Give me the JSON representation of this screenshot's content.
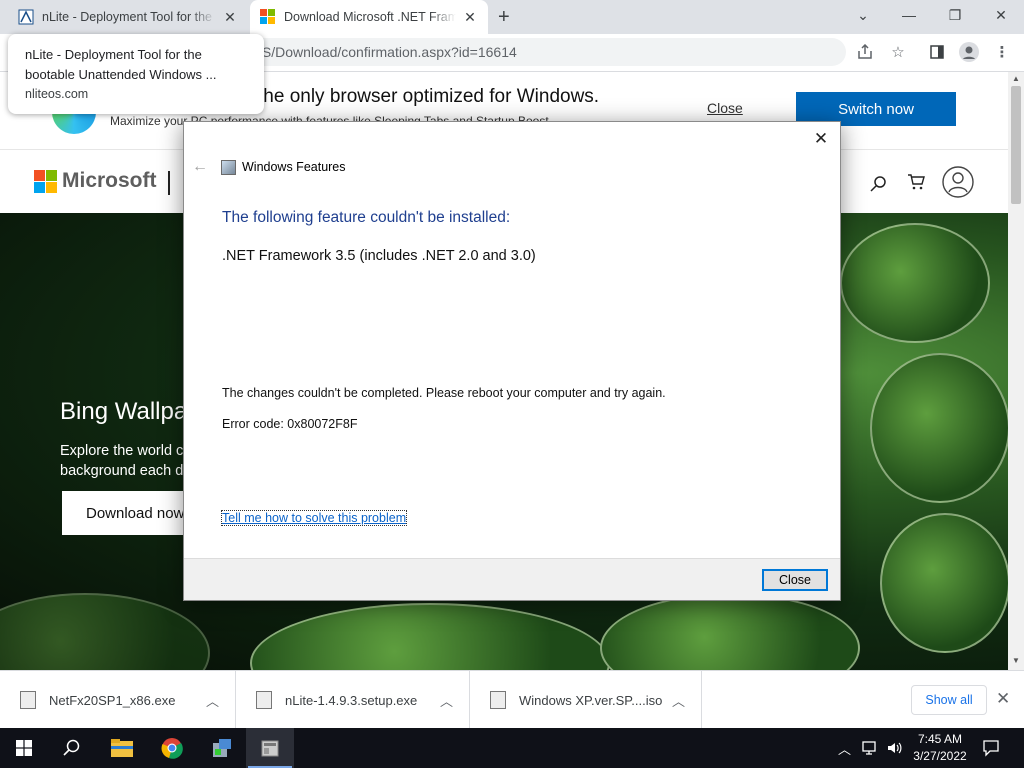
{
  "tabs": [
    {
      "title": "nLite - Deployment Tool for the bootable Unattended Windows installation"
    },
    {
      "title": "Download Microsoft .NET Framework"
    }
  ],
  "tooltip": {
    "title": "nLite - Deployment Tool for the bootable Unattended Windows ...",
    "domain": "nliteos.com"
  },
  "omnibox": {
    "url": "/S/Download/confirmation.aspx?id=16614"
  },
  "edge_banner": {
    "headline": "the only browser optimized for Windows.",
    "subtext": "Maximize your PC performance with features like Sleeping Tabs and Startup Boost",
    "close_label": "Close",
    "switch_label": "Switch now"
  },
  "ms_nav": {
    "logo_text": "Microsoft"
  },
  "hero": {
    "title": "Bing Wallpap",
    "text": "Explore the world c background each d",
    "button_label": "Download now"
  },
  "dialog": {
    "window_title": "Windows Features",
    "heading": "The following feature couldn't be installed:",
    "feature": ".NET Framework 3.5 (includes .NET 2.0 and 3.0)",
    "message": "The changes couldn't be completed. Please reboot your computer and try again.",
    "error": "Error code: 0x80072F8F",
    "link": "Tell me how to solve this problem",
    "close_button": "Close"
  },
  "downloads": {
    "items": [
      {
        "name": "NetFx20SP1_x86.exe"
      },
      {
        "name": "nLite-1.4.9.3.setup.exe"
      },
      {
        "name": "Windows XP.ver.SP....iso"
      }
    ],
    "show_all": "Show all"
  },
  "taskbar": {
    "time": "7:45 AM",
    "date": "3/27/2022"
  },
  "colors": {
    "accent": "#0067b8",
    "dialog_heading": "#1f3f8f",
    "link": "#0b63c9"
  }
}
